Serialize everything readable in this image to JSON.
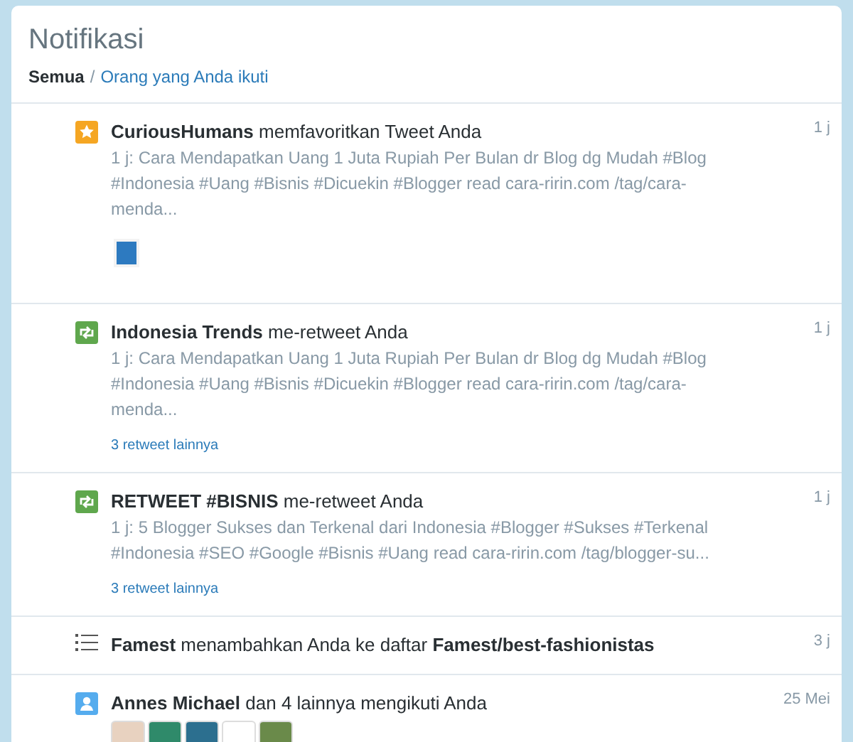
{
  "header": {
    "title": "Notifikasi",
    "separator": "/"
  },
  "filters": [
    {
      "label": "Semua",
      "selected": true
    },
    {
      "label": "Orang yang Anda ikuti",
      "selected": false
    }
  ],
  "notifications": [
    {
      "kind": "favorite",
      "headline": "**CuriousHumans** memfavoritkan Tweet Anda",
      "time": "1 j",
      "body": "1 j: Cara Mendapatkan Uang 1 Juta Rupiah Per Bulan dr Blog dg Mudah #Blog #Indonesia #Uang #Bisnis #Dicuekin #Blogger read cara-ririn.com /tag/cara-menda...",
      "thumbnail": true
    },
    {
      "kind": "retweet",
      "headline": "**Indonesia Trends** me-retweet Anda",
      "time": "1 j",
      "body": "1 j: Cara Mendapatkan Uang 1 Juta Rupiah Per Bulan dr Blog dg Mudah #Blog #Indonesia #Uang #Bisnis #Dicuekin #Blogger read cara-ririn.com /tag/cara-menda...",
      "more_link": "3 retweet lainnya"
    },
    {
      "kind": "retweet",
      "headline": "**RETWEET #BISNIS** me-retweet Anda",
      "time": "1 j",
      "body": "1 j: 5 Blogger Sukses dan Terkenal dari Indonesia #Blogger #Sukses #Terkenal #Indonesia #SEO #Google #Bisnis #Uang read cara-ririn.com /tag/blogger-su...",
      "more_link": "3 retweet lainnya"
    },
    {
      "kind": "list",
      "headline": "**Famest** menambahkan Anda ke daftar **Famest/best-fashionistas**",
      "time": "3 j"
    },
    {
      "kind": "follow",
      "headline": "**Annes Michael** dan 4 lainnya mengikuti Anda",
      "time": "25 Mei",
      "avatars": [
        {
          "color": "#e8d2c0"
        },
        {
          "color": "#2f8a6a"
        },
        {
          "color": "#2c6f8f"
        },
        {
          "color": "#ffffff"
        },
        {
          "color": "#6a8a4a"
        }
      ]
    }
  ]
}
